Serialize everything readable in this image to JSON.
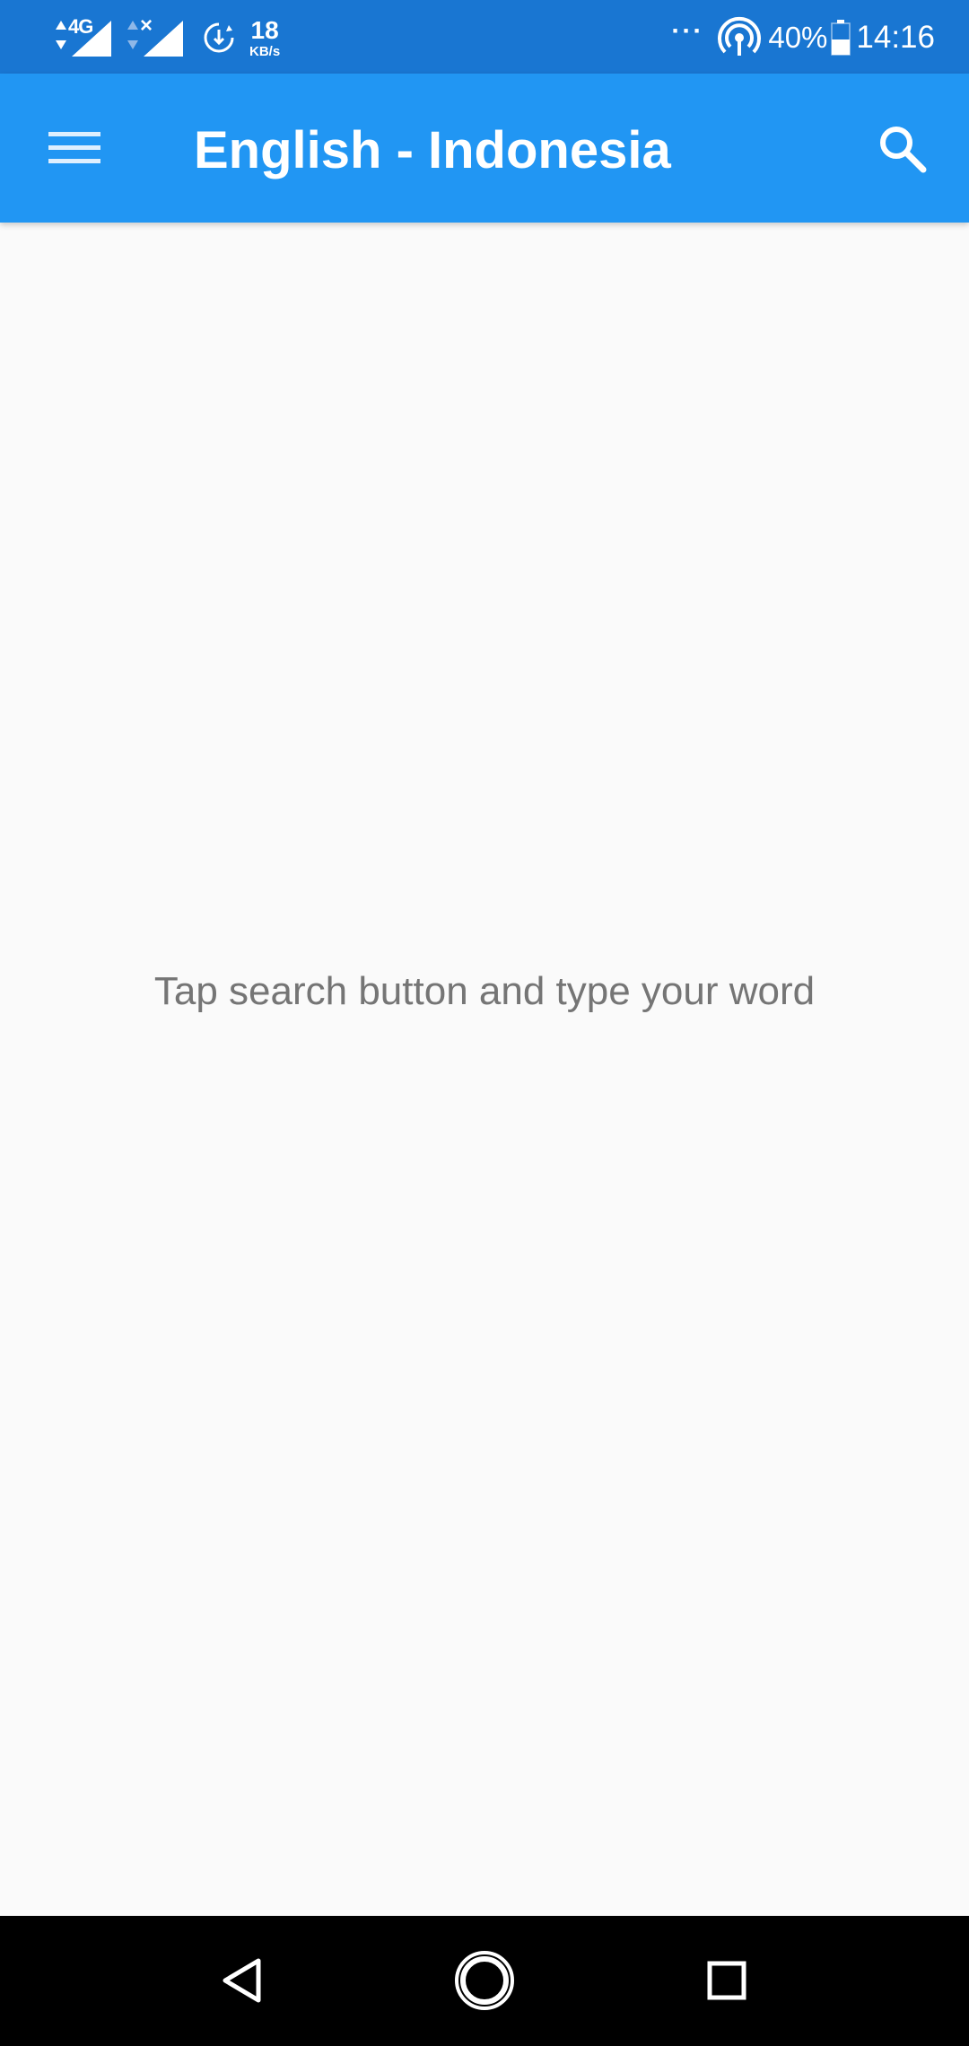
{
  "status_bar": {
    "network_type": "4G",
    "sim2_indicator": "×",
    "speed_value": "18",
    "speed_unit": "KB/s",
    "more_indicator": "···",
    "battery_percent": "40%",
    "time": "14:16",
    "icons": [
      "signal-4g-icon",
      "signal-sim2-icon",
      "data-saver-icon",
      "hotspot-icon",
      "battery-icon"
    ]
  },
  "app_bar": {
    "title": "English - Indonesia",
    "menu_icon": "hamburger-menu-icon",
    "search_icon": "search-icon",
    "background_color": "#2196F3"
  },
  "content": {
    "empty_hint": "Tap search button and type your word",
    "background_color": "#FAFAFA"
  },
  "nav_bar": {
    "icons": [
      "back-triangle-icon",
      "home-circle-icon",
      "recent-square-icon"
    ]
  },
  "colors": {
    "status_bar": "#1976D2",
    "app_bar": "#2196F3",
    "hint_text": "#757575",
    "nav_bar": "#000000"
  }
}
